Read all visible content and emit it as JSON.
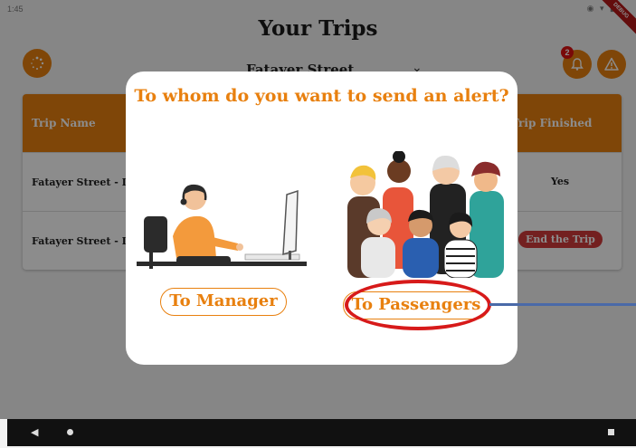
{
  "status_bar": {
    "time": "1:45",
    "icons": "◉ ▾ ▮"
  },
  "debug_banner": "DEBUG",
  "header": {
    "title": "Your Trips",
    "filter_label": "Fatayer Street",
    "filter_chevron": "⌄",
    "notification_count": "2"
  },
  "table": {
    "columns": [
      "Trip Name",
      "Trip Finished"
    ],
    "rows": [
      {
        "trip_name": "Fatayer Street - D",
        "finished": "Yes"
      },
      {
        "trip_name": "Fatayer Street - D",
        "finished": "End the Trip"
      }
    ]
  },
  "dialog": {
    "title": "To whom do you want to send an alert?",
    "manager_button": "To Manager",
    "passengers_button": "To Passengers"
  },
  "colors": {
    "accent": "#e8800f",
    "danger": "#d23b3b",
    "annotation": "#d71a1a",
    "arrow": "#4a6aa8"
  },
  "icons": {
    "menu": "loading-dots-icon",
    "bell": "bell-icon",
    "warning": "warning-triangle-icon"
  }
}
